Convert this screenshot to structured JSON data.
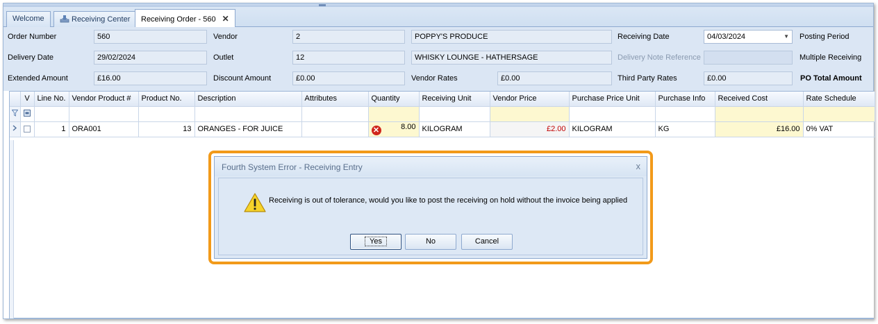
{
  "tabs": [
    {
      "label": "Welcome"
    },
    {
      "label": "Receiving Center"
    },
    {
      "label": "Receiving Order - 560"
    }
  ],
  "form": {
    "order_number_label": "Order Number",
    "order_number": "560",
    "vendor_label": "Vendor",
    "vendor_code": "2",
    "vendor_name": "POPPY'S PRODUCE",
    "receiving_date_label": "Receiving Date",
    "receiving_date": "04/03/2024",
    "posting_period_label": "Posting Period",
    "delivery_date_label": "Delivery Date",
    "delivery_date": "29/02/2024",
    "outlet_label": "Outlet",
    "outlet_code": "12",
    "outlet_name": "WHISKY LOUNGE - HATHERSAGE",
    "delivery_note_label": "Delivery Note Reference",
    "delivery_note": "",
    "multiple_receiving_label": "Multiple Receiving",
    "extended_amount_label": "Extended Amount",
    "extended_amount": "£16.00",
    "discount_amount_label": "Discount Amount",
    "discount_amount": "£0.00",
    "vendor_rates_label": "Vendor Rates",
    "vendor_rates": "£0.00",
    "third_party_rates_label": "Third Party Rates",
    "third_party_rates": "£0.00",
    "po_total_label": "PO Total Amount"
  },
  "grid": {
    "columns": [
      "V",
      "Line No.",
      "Vendor Product #",
      "Product No.",
      "Description",
      "Attributes",
      "Quantity",
      "Receiving Unit",
      "Vendor Price",
      "Purchase Price Unit",
      "Purchase Info",
      "Received Cost",
      "Rate Schedule"
    ],
    "rows": [
      {
        "line_no": "1",
        "vendor_product": "ORA001",
        "product_no": "13",
        "description": "ORANGES - FOR JUICE",
        "attributes": "",
        "quantity": "8.00",
        "receiving_unit": "KILOGRAM",
        "vendor_price": "£2.00",
        "purchase_price_unit": "KILOGRAM",
        "purchase_info": "KG",
        "received_cost": "£16.00",
        "rate_schedule": "0% VAT"
      }
    ]
  },
  "dialog": {
    "title": "Fourth System Error - Receiving Entry",
    "close_glyph": "x",
    "message": "Receiving is out of tolerance, would you like to post the receiving on hold without the invoice being applied",
    "yes_label": "Yes",
    "no_label": "No",
    "cancel_label": "Cancel"
  },
  "icons": {
    "tab_close": "close-icon",
    "error": "error-icon",
    "warning": "warning-icon"
  },
  "colors": {
    "highlight": "#f29a1a",
    "error": "#d0261b",
    "negative_price": "#c00000"
  }
}
